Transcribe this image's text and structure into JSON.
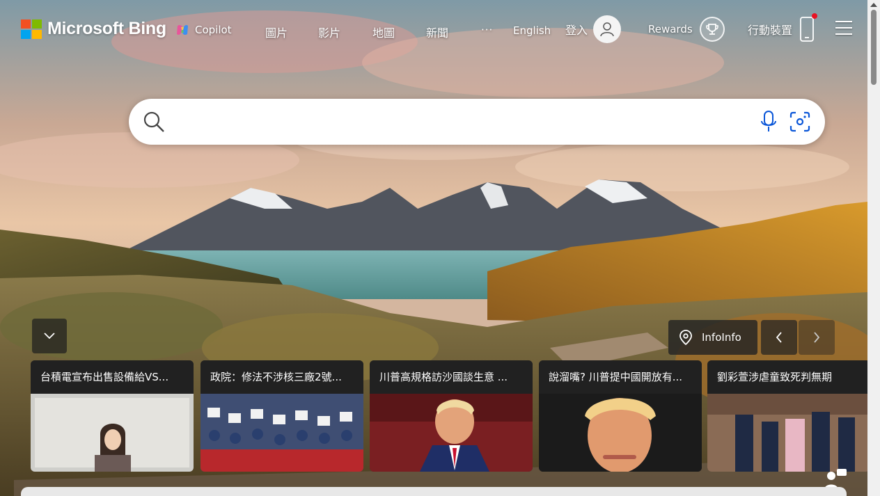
{
  "header": {
    "logo_text": "Microsoft Bing",
    "copilot_label": "Copilot",
    "nav": {
      "images": "圖片",
      "videos": "影片",
      "maps": "地圖",
      "news": "新聞",
      "more": "···",
      "language": "English"
    },
    "signin_label": "登入",
    "rewards_label": "Rewards",
    "mobile_label": "行動裝置"
  },
  "search": {
    "value": "",
    "placeholder": ""
  },
  "info": {
    "label": "InfoInfo"
  },
  "news": [
    {
      "title": "台積電宣布出售設備給VS..."
    },
    {
      "title": "政院：修法不涉核三廠2號..."
    },
    {
      "title": "川普高規格訪沙國談生意 ..."
    },
    {
      "title": "說溜嘴? 川普提中國開放有..."
    },
    {
      "title": "劉彩萱涉虐童致死判無期"
    }
  ],
  "colors": {
    "ms_red": "#f25022",
    "ms_green": "#7fba00",
    "ms_blue": "#00a4ef",
    "ms_yellow": "#ffb900",
    "search_accent": "#0a56d8",
    "notification_dot": "#e81123"
  }
}
